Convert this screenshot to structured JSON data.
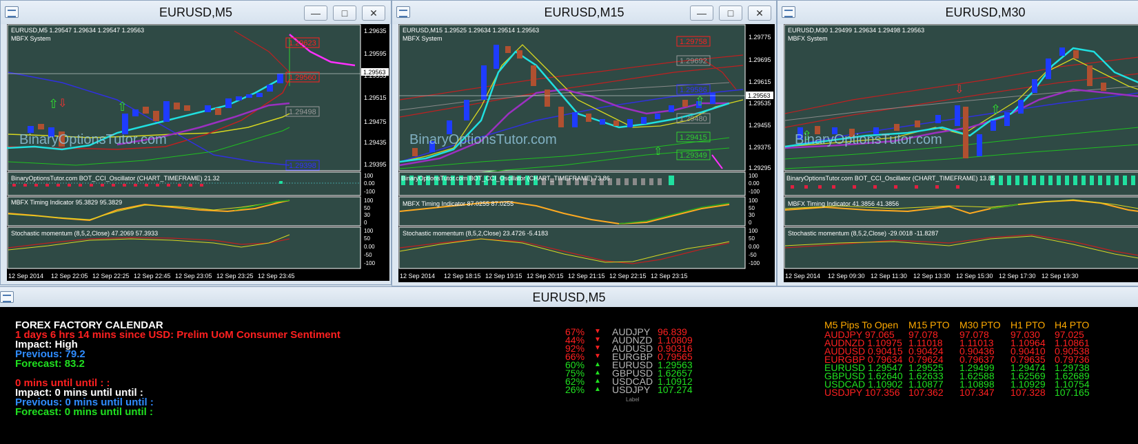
{
  "windows": [
    {
      "id": "m5",
      "title": "EURUSD,M5",
      "info": "EURUSD,M5  1.29547 1.29634 1.29547 1.29563",
      "system": "MBFX System",
      "levels": [
        {
          "v": "1.29623",
          "c": "#ff2020"
        },
        {
          "v": "1.29560",
          "c": "#ff2020"
        },
        {
          "v": "1.29498",
          "c": "#9a9a9a"
        },
        {
          "v": "1.29398",
          "c": "#3030ff"
        }
      ],
      "axis": [
        "1.29635",
        "1.29595",
        "1.29553",
        "1.29515",
        "1.29475",
        "1.29435",
        "1.29395"
      ],
      "current": "1.29563",
      "cci": "BinaryOptionsTutor.com BOT_CCI_Oscillator (CHART_TIMEFRAME) 21.32",
      "timing": "MBFX Timing Indicator 95.3829 95.3829",
      "stoch": "Stochastic momentum (8,5,2,Close) 47.2069 57.3933",
      "times": [
        "12 Sep 2014",
        "12 Sep 22:05",
        "12 Sep 22:25",
        "12 Sep 22:45",
        "12 Sep 23:05",
        "12 Sep 23:25",
        "12 Sep 23:45"
      ]
    },
    {
      "id": "m15",
      "title": "EURUSD,M15",
      "info": "EURUSD,M15  1.29525 1.29634 1.29514 1.29563",
      "system": "MBFX System",
      "levels": [
        {
          "v": "1.29758",
          "c": "#ff2020"
        },
        {
          "v": "1.29692",
          "c": "#9a9a9a"
        },
        {
          "v": "1.29586",
          "c": "#3030ff"
        },
        {
          "v": "1.29480",
          "c": "#9a9a9a"
        },
        {
          "v": "1.29415",
          "c": "#30d030"
        },
        {
          "v": "1.29349",
          "c": "#30d030"
        }
      ],
      "axis": [
        "1.29775",
        "1.29695",
        "1.29615",
        "1.29535",
        "1.29455",
        "1.29375",
        "1.29295"
      ],
      "current": "1.29563",
      "cci": "BinaryOptionsTutor.com BOT_CCI_Oscillator (CHART_TIMEFRAME) 73.86",
      "timing": "MBFX Timing Indicator 87.0255 87.0255",
      "stoch": "Stochastic momentum (8,5,2,Close) 23.4726 -5.4183",
      "times": [
        "12 Sep 2014",
        "12 Sep 18:15",
        "12 Sep 19:15",
        "12 Sep 20:15",
        "12 Sep 21:15",
        "12 Sep 22:15",
        "12 Sep 23:15"
      ]
    },
    {
      "id": "m30",
      "title": "EURUSD,M30",
      "info": "EURUSD,M30  1.29499 1.29634 1.29498 1.29563",
      "system": "MBFX System",
      "levels": [],
      "axis": [],
      "current": "",
      "cci": "BinaryOptionsTutor.com BOT_CCI_Oscillator (CHART_TIMEFRAME) 13.85",
      "timing": "MBFX Timing Indicator 41.3856 41.3856",
      "stoch": "Stochastic momentum (8,5,2,Close) -29.0018 -11.8287",
      "times": [
        "12 Sep 2014",
        "12 Sep 09:30",
        "12 Sep 11:30",
        "12 Sep 13:30",
        "12 Sep 15:30",
        "12 Sep 17:30",
        "12 Sep 19:30"
      ]
    }
  ],
  "watermark": "BinaryOptionsTutor.com",
  "sub_axes": {
    "cci": [
      "100",
      "0.00",
      "-100"
    ],
    "timing": [
      "100",
      "50",
      "30",
      "0"
    ],
    "stoch": [
      "100",
      "50",
      "0.00",
      "-50",
      "-100"
    ]
  },
  "calendar": {
    "title": "EURUSD,M5",
    "heading": "FOREX FACTORY CALENDAR",
    "line1": "1 days 6 hrs 14 mins since USD: Prelim UoM Consumer Sentiment",
    "impact": "Impact: High",
    "previous": "Previous: 79.2",
    "forecast": "Forecast: 83.2",
    "line5": "0 mins until until : :",
    "impact2": "Impact: 0 mins until until :",
    "previous2": "Previous: 0 mins until until :",
    "forecast2": "Forecast: 0 mins until until :",
    "strength": [
      {
        "pct": "67%",
        "dir": "down",
        "pair": "AUDJPY",
        "price": "96.839"
      },
      {
        "pct": "44%",
        "dir": "down",
        "pair": "AUDNZD",
        "price": "1.10809"
      },
      {
        "pct": "92%",
        "dir": "down",
        "pair": "AUDUSD",
        "price": "0.90316"
      },
      {
        "pct": "66%",
        "dir": "down",
        "pair": "EURGBP",
        "price": "0.79565"
      },
      {
        "pct": "60%",
        "dir": "up",
        "pair": "EURUSD",
        "price": "1.29563"
      },
      {
        "pct": "75%",
        "dir": "up",
        "pair": "GBPUSD",
        "price": "1.62657"
      },
      {
        "pct": "62%",
        "dir": "up",
        "pair": "USDCAD",
        "price": "1.10912"
      },
      {
        "pct": "26%",
        "dir": "up",
        "pair": "USDJPY",
        "price": "107.274"
      }
    ],
    "label_tag": "Label",
    "pto_headers": [
      "M5 Pips To Open",
      "M15 PTO",
      "M30 PTO",
      "H1 PTO",
      "H4 PTO"
    ],
    "pto_rows": [
      {
        "c": "#ff2020",
        "cells": [
          "AUDJPY 97.065",
          "97.078",
          "97.078",
          "97.030",
          "97.025"
        ]
      },
      {
        "c": "#ff2020",
        "cells": [
          "AUDNZD 1.10975",
          "1.11018",
          "1.11013",
          "1.10964",
          "1.10861"
        ]
      },
      {
        "c": "#ff2020",
        "cells": [
          "AUDUSD 0.90415",
          "0.90424",
          "0.90436",
          "0.90410",
          "0.90538"
        ]
      },
      {
        "c": "#ff2020",
        "cells": [
          "EURGBP 0.79634",
          "0.79624",
          "0.79637",
          "0.79635",
          "0.79736"
        ]
      },
      {
        "c": "#20e020",
        "cells": [
          "EURUSD 1.29547",
          "1.29525",
          "1.29499",
          "1.29474",
          "1.29738"
        ]
      },
      {
        "c": "#20e020",
        "cells": [
          "GBPUSD 1.62640",
          "1.62633",
          "1.62588",
          "1.62569",
          "1.62689"
        ]
      },
      {
        "c": "#20e020",
        "cells": [
          "USDCAD 1.10902",
          "1.10877",
          "1.10898",
          "1.10929",
          "1.10754"
        ]
      },
      {
        "c": "#ff2020",
        "cells": [
          "USDJPY 107.356",
          "107.362",
          "107.347",
          "107.328",
          "107.165"
        ]
      }
    ],
    "pto_last_col_colors": [
      "#ff2020",
      "#ff2020",
      "#ff2020",
      "#ff2020",
      "#20e020",
      "#20e020",
      "#20e020",
      "#20e020"
    ]
  }
}
